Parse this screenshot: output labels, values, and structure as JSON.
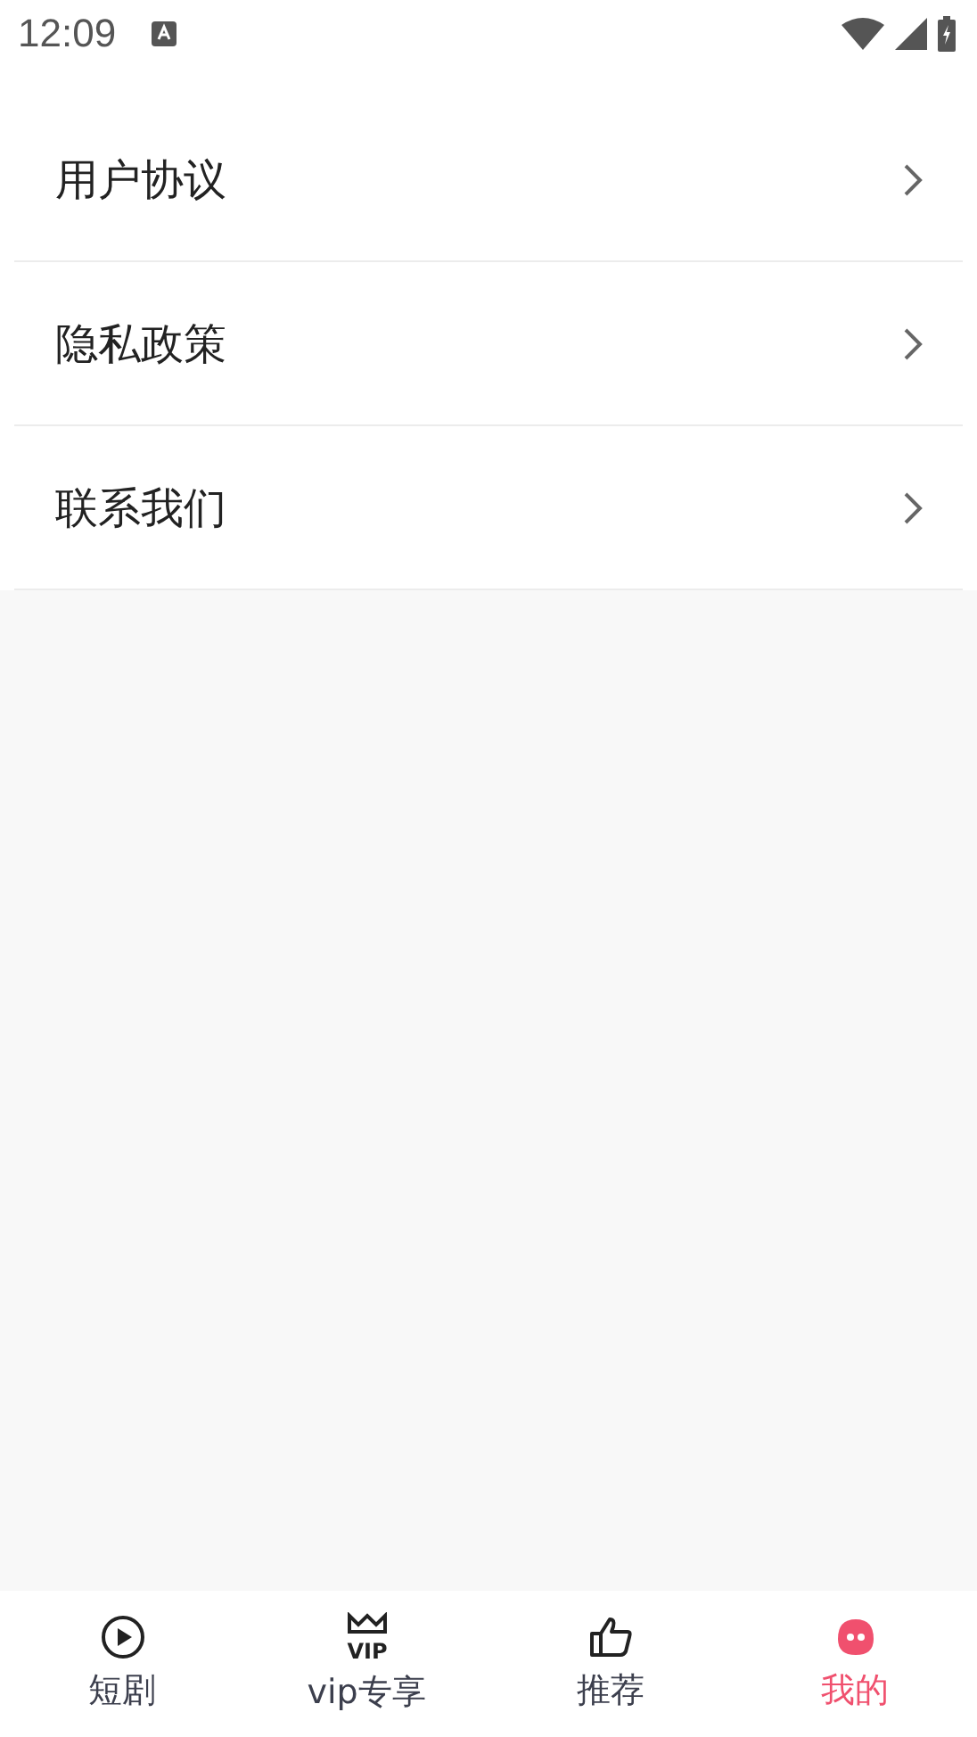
{
  "status_bar": {
    "time": "12:09"
  },
  "menu": [
    {
      "label": "用户协议"
    },
    {
      "label": "隐私政策"
    },
    {
      "label": "联系我们"
    }
  ],
  "tab_bar": [
    {
      "label": "短剧",
      "kind": "play",
      "selected": false
    },
    {
      "label": "vip专享",
      "kind": "vip",
      "icon_text": "VIP",
      "selected": false
    },
    {
      "label": "推荐",
      "kind": "thumb",
      "selected": false
    },
    {
      "label": "我的",
      "kind": "face",
      "selected": true
    }
  ]
}
